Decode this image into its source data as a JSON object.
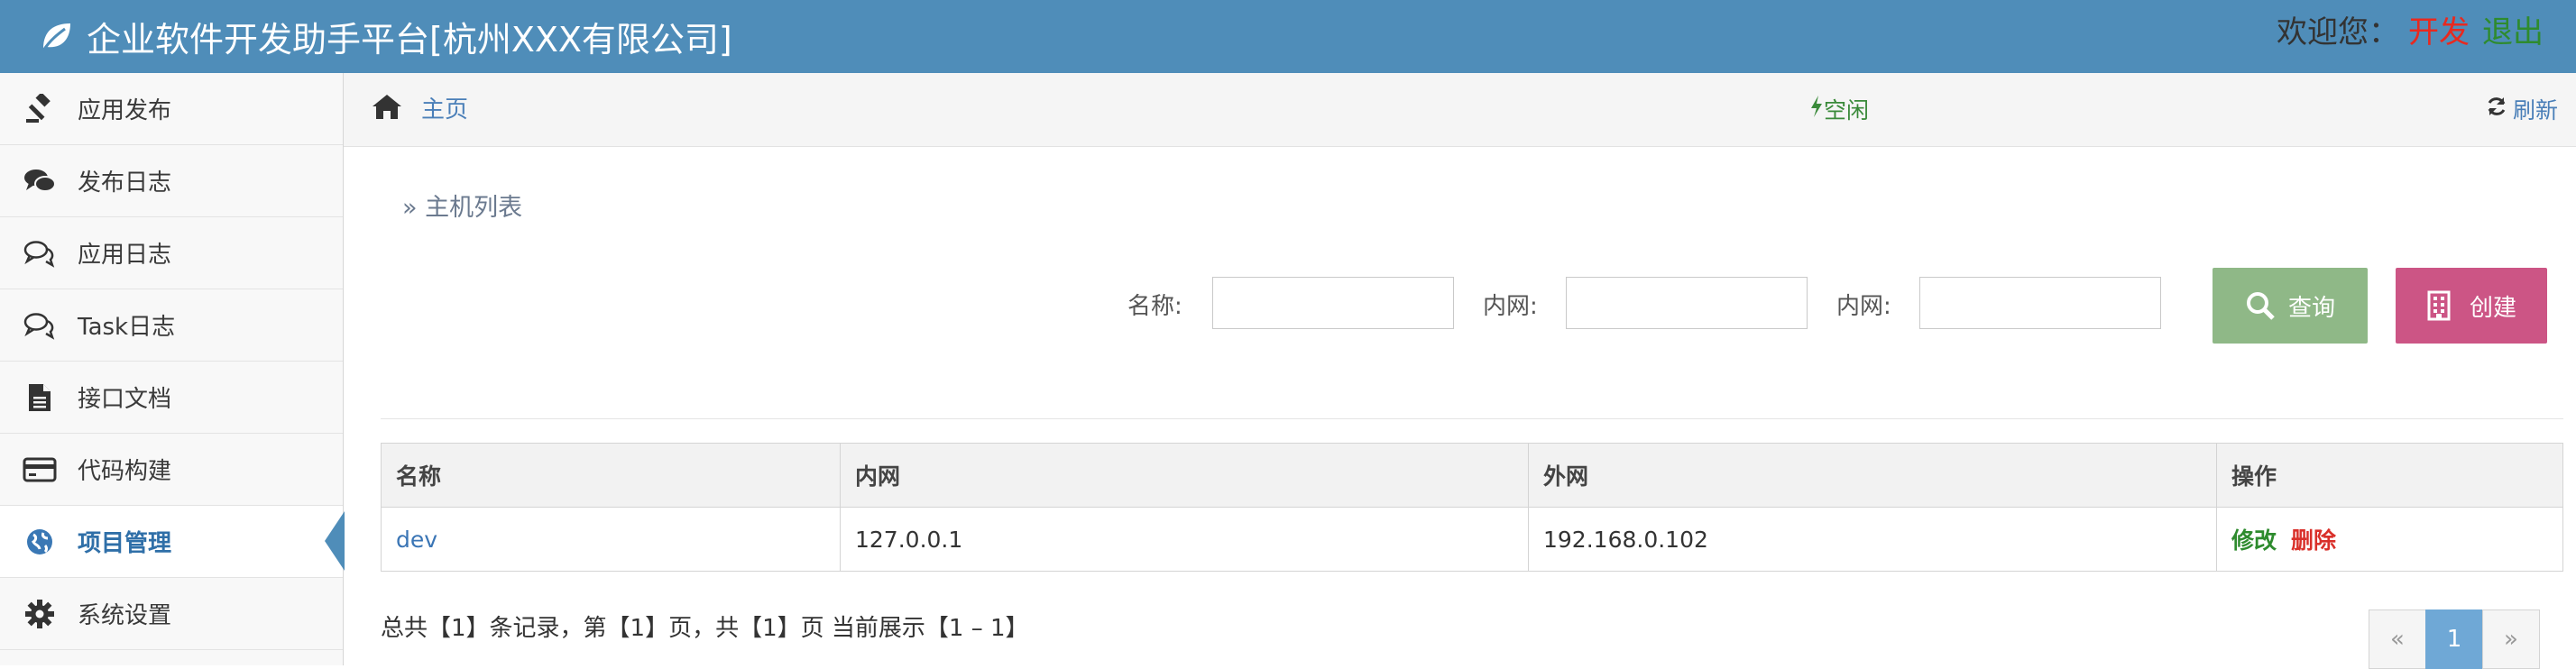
{
  "header": {
    "title": "企业软件开发助手平台[杭州XXX有限公司]",
    "welcome": "欢迎您：",
    "username": "开发",
    "logout": "退出",
    "brand_icon": "leaf-icon"
  },
  "sidebar": {
    "items": [
      {
        "label": "应用发布",
        "icon": "gavel-icon"
      },
      {
        "label": "发布日志",
        "icon": "comments-icon"
      },
      {
        "label": "应用日志",
        "icon": "comments-outline-icon"
      },
      {
        "label": "Task日志",
        "icon": "comments-outline-icon"
      },
      {
        "label": "接口文档",
        "icon": "file-text-icon"
      },
      {
        "label": "代码构建",
        "icon": "credit-card-icon"
      },
      {
        "label": "项目管理",
        "icon": "globe-icon",
        "active": true
      },
      {
        "label": "系统设置",
        "icon": "gear-icon"
      }
    ]
  },
  "breadcrumb": {
    "home": "主页",
    "status": "空闲",
    "refresh": "刷新"
  },
  "main": {
    "section_title": "» 主机列表",
    "filters": [
      {
        "label": "名称:",
        "value": ""
      },
      {
        "label": "内网:",
        "value": ""
      },
      {
        "label": "内网:",
        "value": ""
      }
    ],
    "search_button": "查询",
    "create_button": "创建"
  },
  "table": {
    "columns": [
      "名称",
      "内网",
      "外网",
      "操作"
    ],
    "rows": [
      {
        "name": "dev",
        "internal": "127.0.0.1",
        "external": "192.168.0.102",
        "edit": "修改",
        "delete": "删除"
      }
    ]
  },
  "pagination": {
    "summary": "总共【1】条记录，第【1】页，共【1】页 当前展示【1 – 1】",
    "prev": "«",
    "current": "1",
    "next": "»"
  },
  "colors": {
    "header": "#4f8db9",
    "search_button": "#8fb887",
    "create_button": "#cc5585",
    "active_page": "#6fa8d6"
  }
}
